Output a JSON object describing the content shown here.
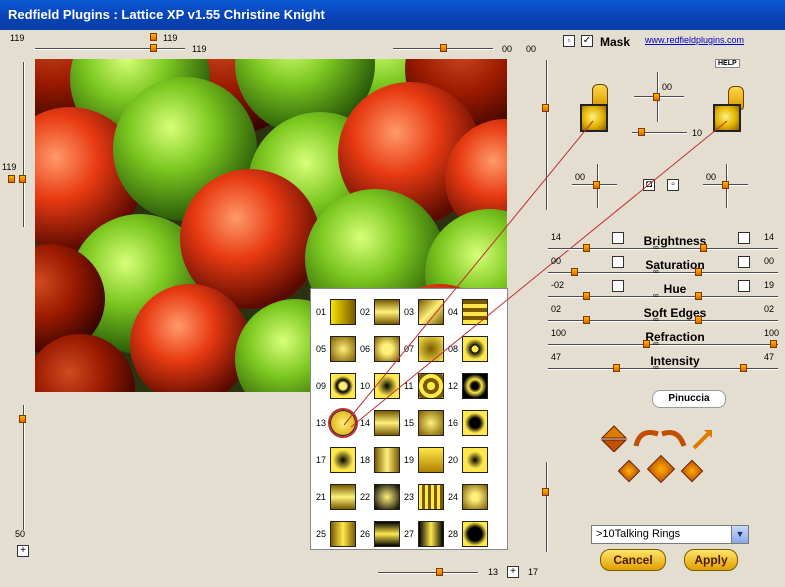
{
  "window": {
    "title": "Redfield Plugins : Lattice XP v1.55   Christine Knight"
  },
  "top": {
    "val_a": "119",
    "val_b": "119",
    "val_c": "119",
    "right_a": "00",
    "right_b": "00"
  },
  "left": {
    "val_mid": "119",
    "val_bottom": "50"
  },
  "bottom": {
    "val_a": "13",
    "val_b": "17"
  },
  "mask": {
    "label": "Mask",
    "checked": true,
    "link": "www.redfieldplugins.com",
    "help": "HELP"
  },
  "lever": {
    "val_top": "00",
    "val_mid": "10",
    "val_left": "00",
    "val_right": "00"
  },
  "sliders": [
    {
      "name": "Brightness",
      "left": "14",
      "right": "14"
    },
    {
      "name": "Saturation",
      "left": "00",
      "right": "00"
    },
    {
      "name": "Hue",
      "left": "-02",
      "right": "19"
    },
    {
      "name": "Soft Edges",
      "left": "02",
      "right": "02"
    },
    {
      "name": "Refraction",
      "left": "100",
      "right": "100"
    },
    {
      "name": "Intensity",
      "left": "47",
      "right": "47"
    }
  ],
  "preset_badge": "Pinuccia",
  "patterns": [
    "01",
    "02",
    "03",
    "04",
    "05",
    "06",
    "07",
    "08",
    "09",
    "10",
    "11",
    "12",
    "13",
    "14",
    "15",
    "16",
    "17",
    "18",
    "19",
    "20",
    "21",
    "22",
    "23",
    "24",
    "25",
    "26",
    "27",
    "28"
  ],
  "preset_select": {
    "value": ">10Talking Rings"
  },
  "buttons": {
    "cancel": "Cancel",
    "apply": "Apply"
  },
  "colors": {
    "accent": "#e07a00",
    "gold": "#f0c800",
    "title_bg": "#0842b4"
  }
}
